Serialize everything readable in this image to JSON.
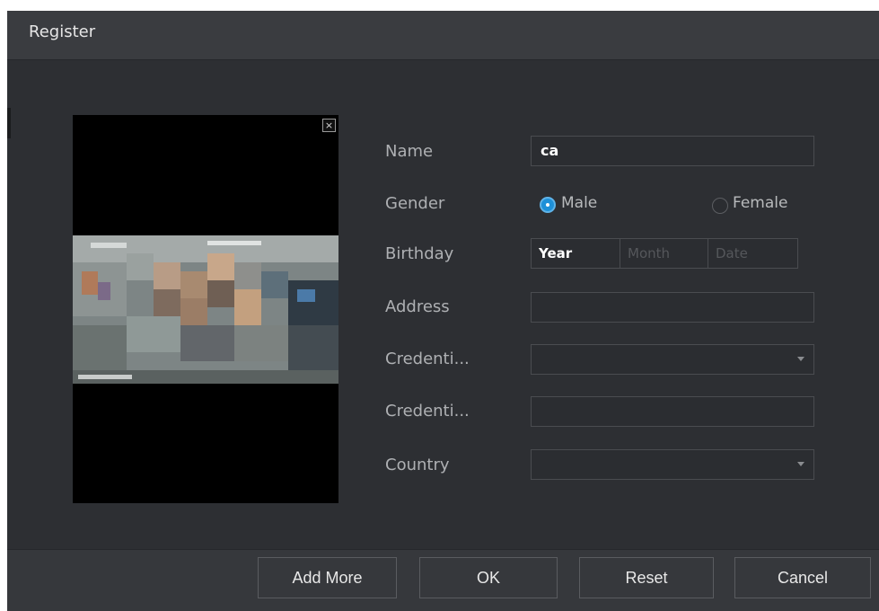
{
  "dialog": {
    "title": "Register"
  },
  "photo": {
    "close_icon": "close-icon",
    "close_glyph": "×"
  },
  "form": {
    "name_label": "Name",
    "name_value": "ca",
    "gender_label": "Gender",
    "gender_options": [
      "Male",
      "Female"
    ],
    "gender_selected": "Male",
    "birthday_label": "Birthday",
    "birthday_year": "Year",
    "birthday_month": "Month",
    "birthday_date": "Date",
    "address_label": "Address",
    "address_value": "",
    "credential_type_label": "Credenti...",
    "credential_type_value": "",
    "credential_no_label": "Credenti...",
    "credential_no_value": "",
    "country_label": "Country",
    "country_value": ""
  },
  "footer": {
    "add_more_label": "Add More",
    "ok_label": "OK",
    "reset_label": "Reset",
    "cancel_label": "Cancel"
  },
  "colors": {
    "dialog_bg": "#2d2f33",
    "titlebar_bg": "#3a3c40",
    "accent": "#1e90d8",
    "input_border": "#4a4c50"
  }
}
